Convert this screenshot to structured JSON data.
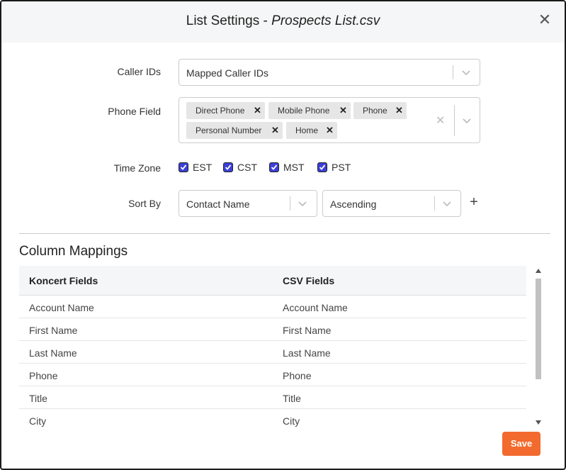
{
  "dialog": {
    "title_prefix": "List Settings - ",
    "title_name": "Prospects List.csv",
    "close_glyph": "✕"
  },
  "form": {
    "caller_ids": {
      "label": "Caller IDs",
      "value": "Mapped Caller IDs"
    },
    "phone_field": {
      "label": "Phone Field",
      "tags": [
        "Direct Phone",
        "Mobile Phone",
        "Phone",
        "Personal Number",
        "Home"
      ],
      "clear_glyph": "✕",
      "remove_glyph": "✕"
    },
    "time_zone": {
      "label": "Time Zone",
      "options": [
        {
          "label": "EST",
          "checked": true
        },
        {
          "label": "CST",
          "checked": true
        },
        {
          "label": "MST",
          "checked": true
        },
        {
          "label": "PST",
          "checked": true
        }
      ]
    },
    "sort_by": {
      "label": "Sort By",
      "field_value": "Contact Name",
      "order_value": "Ascending",
      "add_glyph": "+"
    }
  },
  "mappings": {
    "title": "Column Mappings",
    "headers": [
      "Koncert Fields",
      "CSV Fields"
    ],
    "rows": [
      [
        "Account Name",
        "Account Name"
      ],
      [
        "First Name",
        "First Name"
      ],
      [
        "Last Name",
        "Last Name"
      ],
      [
        "Phone",
        "Phone"
      ],
      [
        "Title",
        "Title"
      ],
      [
        "City",
        "City"
      ]
    ]
  },
  "footer": {
    "save_label": "Save"
  },
  "colors": {
    "accent": "#f26a2e",
    "checkbox": "#3b3fd6"
  }
}
